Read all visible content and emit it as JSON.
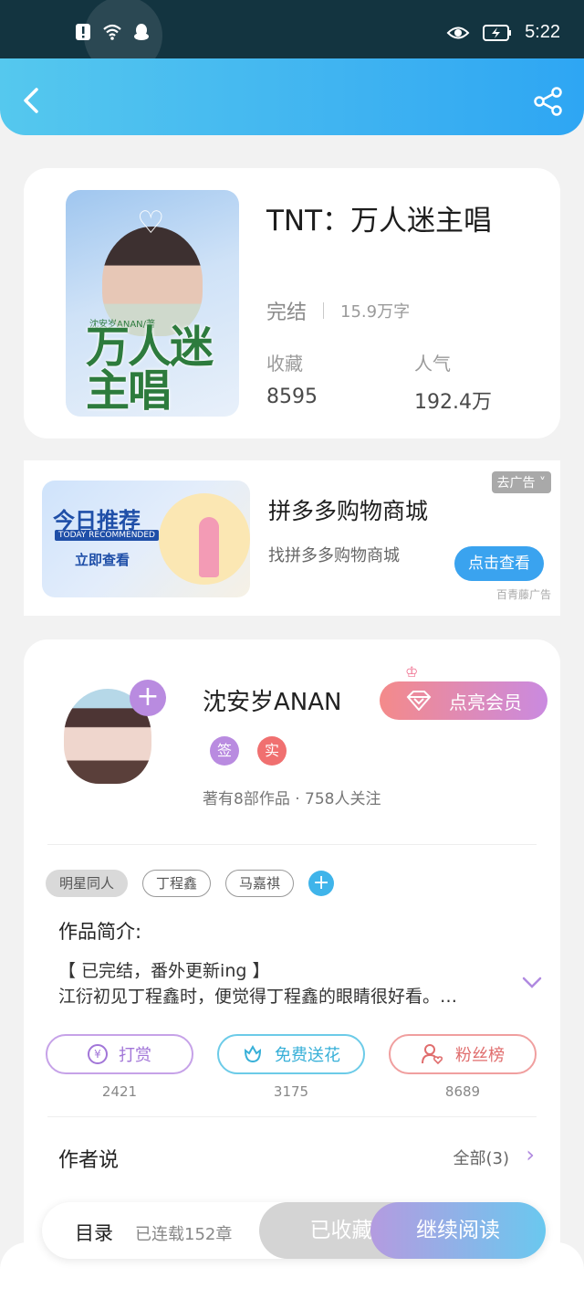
{
  "status_bar": {
    "time": "5:22",
    "icons": [
      "alert-icon",
      "wifi-icon",
      "qq-icon",
      "eye-icon",
      "battery-icon"
    ]
  },
  "book": {
    "title": "TNT：万人迷主唱",
    "status": "完结",
    "word_count": "15.9万字",
    "favorites_label": "收藏",
    "favorites_value": "8595",
    "popularity_label": "人气",
    "popularity_value": "192.4万",
    "cover_title": "万人迷主唱",
    "cover_author": "沈安岁ANAN/著"
  },
  "ad": {
    "remove_label": "去广告",
    "image_title": "今日推荐",
    "image_subtitle": "TODAY RECOMMENDED",
    "image_cta": "立即查看",
    "title": "拼多多购物商城",
    "subtitle": "找拼多多购物商城",
    "button": "点击查看",
    "source": "百青藤广告"
  },
  "author": {
    "name": "沈安岁ANAN",
    "vip_button": "点亮会员",
    "badge_sign": "签",
    "badge_real": "实",
    "meta": "著有8部作品 · 758人关注"
  },
  "tags": [
    "明星同人",
    "丁程鑫",
    "马嘉祺"
  ],
  "intro": {
    "heading": "作品简介:",
    "line1": "【 已完结，番外更新ing 】",
    "line2": "江衍初见丁程鑫时，便觉得丁程鑫的眼睛很好看。…"
  },
  "actions": {
    "reward_label": "打赏",
    "reward_count": "2421",
    "flower_label": "免费送花",
    "flower_count": "3175",
    "fans_label": "粉丝榜",
    "fans_count": "8689"
  },
  "author_says": {
    "heading": "作者说",
    "all_label": "全部(3)"
  },
  "bottom_bar": {
    "toc": "目录",
    "serial": "已连载152章",
    "collected": "已收藏",
    "continue": "继续阅读"
  },
  "colors": {
    "header_blue": "#3fb3f1",
    "purple": "#b98be0",
    "accent_blue": "#3aa3ef"
  }
}
